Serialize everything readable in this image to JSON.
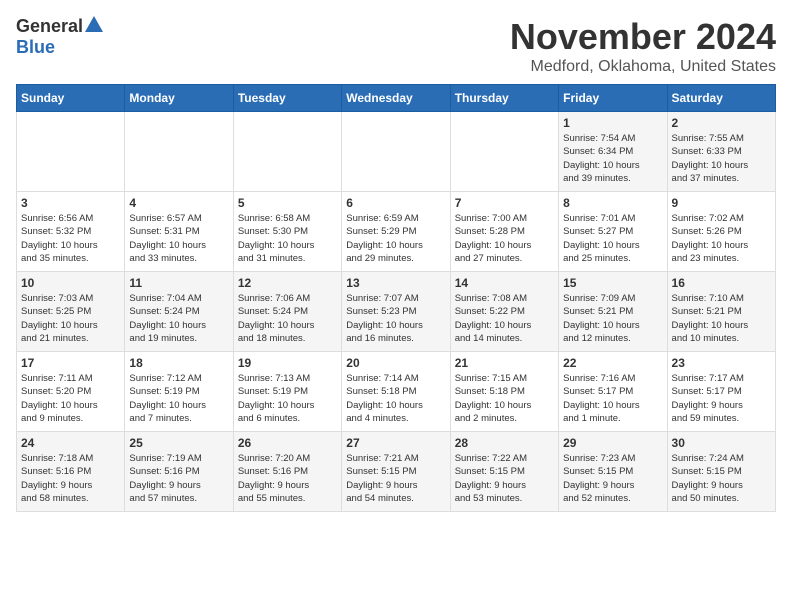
{
  "logo": {
    "general": "General",
    "blue": "Blue"
  },
  "title": "November 2024",
  "location": "Medford, Oklahoma, United States",
  "days_of_week": [
    "Sunday",
    "Monday",
    "Tuesday",
    "Wednesday",
    "Thursday",
    "Friday",
    "Saturday"
  ],
  "weeks": [
    [
      {
        "day": "",
        "info": ""
      },
      {
        "day": "",
        "info": ""
      },
      {
        "day": "",
        "info": ""
      },
      {
        "day": "",
        "info": ""
      },
      {
        "day": "",
        "info": ""
      },
      {
        "day": "1",
        "info": "Sunrise: 7:54 AM\nSunset: 6:34 PM\nDaylight: 10 hours\nand 39 minutes."
      },
      {
        "day": "2",
        "info": "Sunrise: 7:55 AM\nSunset: 6:33 PM\nDaylight: 10 hours\nand 37 minutes."
      }
    ],
    [
      {
        "day": "3",
        "info": "Sunrise: 6:56 AM\nSunset: 5:32 PM\nDaylight: 10 hours\nand 35 minutes."
      },
      {
        "day": "4",
        "info": "Sunrise: 6:57 AM\nSunset: 5:31 PM\nDaylight: 10 hours\nand 33 minutes."
      },
      {
        "day": "5",
        "info": "Sunrise: 6:58 AM\nSunset: 5:30 PM\nDaylight: 10 hours\nand 31 minutes."
      },
      {
        "day": "6",
        "info": "Sunrise: 6:59 AM\nSunset: 5:29 PM\nDaylight: 10 hours\nand 29 minutes."
      },
      {
        "day": "7",
        "info": "Sunrise: 7:00 AM\nSunset: 5:28 PM\nDaylight: 10 hours\nand 27 minutes."
      },
      {
        "day": "8",
        "info": "Sunrise: 7:01 AM\nSunset: 5:27 PM\nDaylight: 10 hours\nand 25 minutes."
      },
      {
        "day": "9",
        "info": "Sunrise: 7:02 AM\nSunset: 5:26 PM\nDaylight: 10 hours\nand 23 minutes."
      }
    ],
    [
      {
        "day": "10",
        "info": "Sunrise: 7:03 AM\nSunset: 5:25 PM\nDaylight: 10 hours\nand 21 minutes."
      },
      {
        "day": "11",
        "info": "Sunrise: 7:04 AM\nSunset: 5:24 PM\nDaylight: 10 hours\nand 19 minutes."
      },
      {
        "day": "12",
        "info": "Sunrise: 7:06 AM\nSunset: 5:24 PM\nDaylight: 10 hours\nand 18 minutes."
      },
      {
        "day": "13",
        "info": "Sunrise: 7:07 AM\nSunset: 5:23 PM\nDaylight: 10 hours\nand 16 minutes."
      },
      {
        "day": "14",
        "info": "Sunrise: 7:08 AM\nSunset: 5:22 PM\nDaylight: 10 hours\nand 14 minutes."
      },
      {
        "day": "15",
        "info": "Sunrise: 7:09 AM\nSunset: 5:21 PM\nDaylight: 10 hours\nand 12 minutes."
      },
      {
        "day": "16",
        "info": "Sunrise: 7:10 AM\nSunset: 5:21 PM\nDaylight: 10 hours\nand 10 minutes."
      }
    ],
    [
      {
        "day": "17",
        "info": "Sunrise: 7:11 AM\nSunset: 5:20 PM\nDaylight: 10 hours\nand 9 minutes."
      },
      {
        "day": "18",
        "info": "Sunrise: 7:12 AM\nSunset: 5:19 PM\nDaylight: 10 hours\nand 7 minutes."
      },
      {
        "day": "19",
        "info": "Sunrise: 7:13 AM\nSunset: 5:19 PM\nDaylight: 10 hours\nand 6 minutes."
      },
      {
        "day": "20",
        "info": "Sunrise: 7:14 AM\nSunset: 5:18 PM\nDaylight: 10 hours\nand 4 minutes."
      },
      {
        "day": "21",
        "info": "Sunrise: 7:15 AM\nSunset: 5:18 PM\nDaylight: 10 hours\nand 2 minutes."
      },
      {
        "day": "22",
        "info": "Sunrise: 7:16 AM\nSunset: 5:17 PM\nDaylight: 10 hours\nand 1 minute."
      },
      {
        "day": "23",
        "info": "Sunrise: 7:17 AM\nSunset: 5:17 PM\nDaylight: 9 hours\nand 59 minutes."
      }
    ],
    [
      {
        "day": "24",
        "info": "Sunrise: 7:18 AM\nSunset: 5:16 PM\nDaylight: 9 hours\nand 58 minutes."
      },
      {
        "day": "25",
        "info": "Sunrise: 7:19 AM\nSunset: 5:16 PM\nDaylight: 9 hours\nand 57 minutes."
      },
      {
        "day": "26",
        "info": "Sunrise: 7:20 AM\nSunset: 5:16 PM\nDaylight: 9 hours\nand 55 minutes."
      },
      {
        "day": "27",
        "info": "Sunrise: 7:21 AM\nSunset: 5:15 PM\nDaylight: 9 hours\nand 54 minutes."
      },
      {
        "day": "28",
        "info": "Sunrise: 7:22 AM\nSunset: 5:15 PM\nDaylight: 9 hours\nand 53 minutes."
      },
      {
        "day": "29",
        "info": "Sunrise: 7:23 AM\nSunset: 5:15 PM\nDaylight: 9 hours\nand 52 minutes."
      },
      {
        "day": "30",
        "info": "Sunrise: 7:24 AM\nSunset: 5:15 PM\nDaylight: 9 hours\nand 50 minutes."
      }
    ]
  ]
}
